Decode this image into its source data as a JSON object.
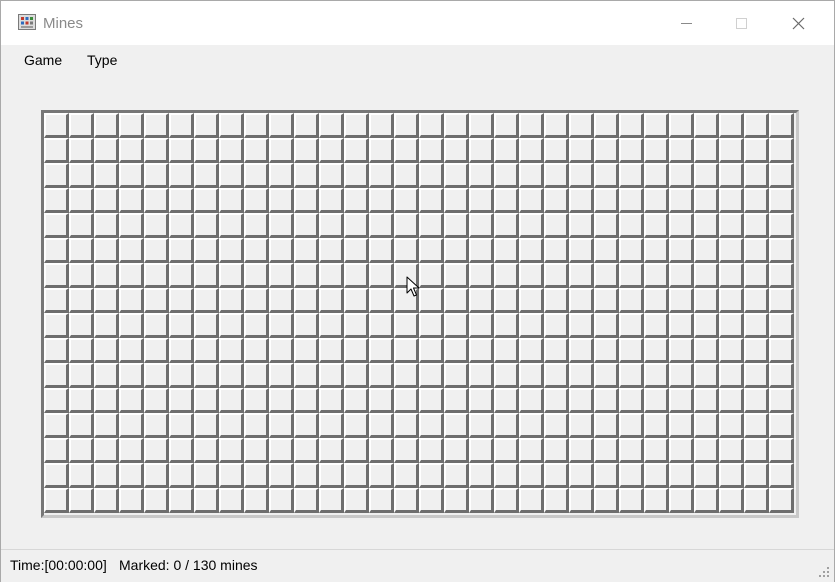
{
  "window": {
    "title": "Mines"
  },
  "menu": {
    "items": [
      {
        "label": "Game"
      },
      {
        "label": "Type"
      }
    ]
  },
  "board": {
    "columns": 30,
    "rows": 16,
    "cell_state": "unrevealed"
  },
  "status": {
    "time": "Time:[00:00:00]",
    "marked": "Marked: 0 / 130 mines"
  },
  "colors": {
    "window_bg": "#f0f0f0",
    "titlebar_bg": "#ffffff",
    "cell_shadow": "#6e6e6e",
    "cell_highlight": "#ffffff"
  }
}
